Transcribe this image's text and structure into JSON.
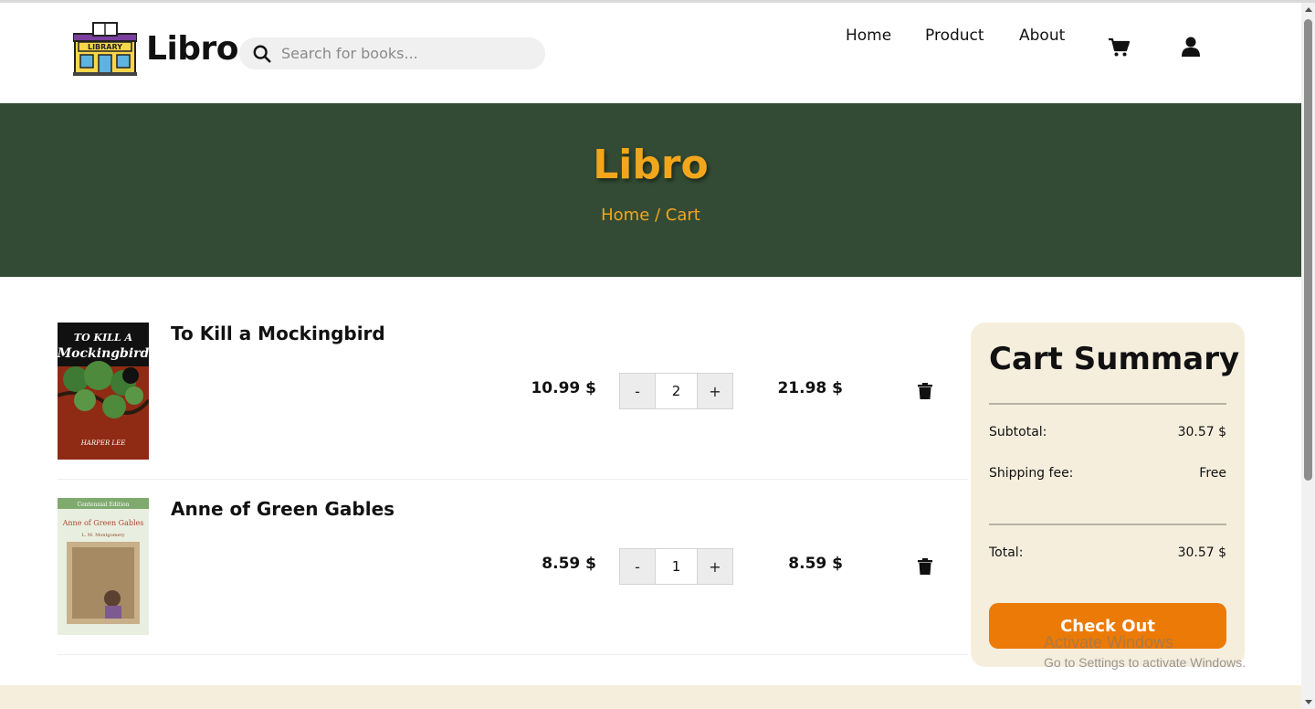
{
  "header": {
    "logo_text": "Libro",
    "logo_sign_text": "LIBRARY",
    "search_placeholder": "Search for books...",
    "nav": {
      "home": "Home",
      "product": "Product",
      "about": "About"
    }
  },
  "hero": {
    "title": "Libro",
    "breadcrumb_home": "Home",
    "breadcrumb_sep": " / ",
    "breadcrumb_current": "Cart"
  },
  "cart": {
    "items": [
      {
        "title": "To Kill a Mockingbird",
        "cover_line1": "TO KILL A",
        "cover_line2": "Mockingbird",
        "cover_author": "HARPER LEE",
        "price": "10.99 $",
        "minus": "-",
        "quantity": "2",
        "plus": "+",
        "total": "21.98 $"
      },
      {
        "title": "Anne of Green Gables",
        "cover_line1": "Centennial Edition",
        "cover_line2": "Anne of Green Gables",
        "cover_author": "L. M. Montgomery",
        "price": "8.59 $",
        "minus": "-",
        "quantity": "1",
        "plus": "+",
        "total": "8.59 $"
      }
    ]
  },
  "summary": {
    "title": "Cart Summary",
    "subtotal_label": "Subtotal:",
    "subtotal_value": "30.57 $",
    "shipping_label": "Shipping fee:",
    "shipping_value": "Free",
    "total_label": "Total:",
    "total_value": "30.57 $",
    "checkout_label": "Check Out"
  },
  "watermark": {
    "line1": "Activate Windows",
    "line2": "Go to Settings to activate Windows."
  },
  "colors": {
    "hero_bg": "#334b34",
    "accent": "#f2a61c",
    "checkout": "#ec7a06",
    "summary_bg": "#f6eedd"
  }
}
